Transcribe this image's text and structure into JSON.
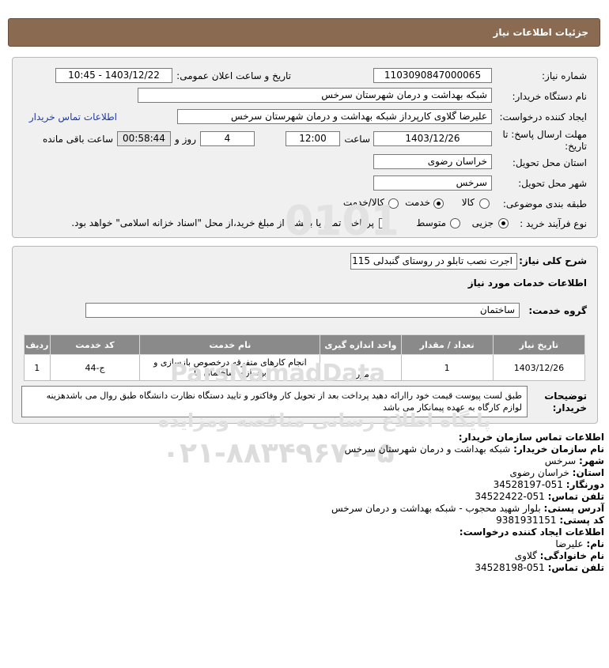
{
  "page": {
    "title": "جزئیات اطلاعات نیاز"
  },
  "details": {
    "need_number_label": "شماره نیاز:",
    "need_number": "1103090847000065",
    "announce_label": "تاریخ و ساعت اعلان عمومی:",
    "announce_value": "1403/12/22 - 10:45",
    "buyer_org_label": "نام دستگاه خریدار:",
    "buyer_org": "شبکه بهداشت و درمان شهرستان سرخس",
    "requester_label": "ایجاد کننده درخواست:",
    "requester": "علیرضا گلاوی کارپرداز شبکه بهداشت و درمان شهرستان سرخس",
    "contact_link": "اطلاعات تماس خریدار",
    "deadline_label_1": "مهلت ارسال پاسخ: تا",
    "deadline_label_2": "تاریخ:",
    "deadline_date": "1403/12/26",
    "time_label": "ساعت",
    "deadline_time": "12:00",
    "days_value": "4",
    "days_label": "روز و",
    "remaining_time": "00:58:44",
    "remaining_label": "ساعت باقی مانده",
    "province_label": "استان محل تحویل:",
    "province": "خراسان رضوی",
    "city_label": "شهر محل تحویل:",
    "city": "سرخس",
    "category_label": "طبقه بندی موضوعی:",
    "category_options": [
      "کالا",
      "خدمت",
      "کالا/خدمت"
    ],
    "category_selected": "خدمت",
    "process_label": "نوع فرآیند خرید :",
    "process_options": [
      "جزیی",
      "متوسط"
    ],
    "process_selected": "جزیی",
    "payment_note": "پرداخت تمام یا بخشی از مبلغ خرید،از محل \"اسناد خزانه اسلامی\" خواهد بود."
  },
  "summary": {
    "desc_label": "شرح کلی نیاز:",
    "desc_value": "اجرت نصب تابلو در روستای گنبدلی 115",
    "services_heading": "اطلاعات خدمات مورد نیاز",
    "group_label": "گروه خدمت:",
    "group_value": "ساختمان"
  },
  "table": {
    "headers": [
      "ردیف",
      "کد خدمت",
      "نام خدمت",
      "واحد اندازه گیری",
      "تعداد / مقدار",
      "تاریخ نیاز"
    ],
    "rows": [
      [
        "1",
        "ج-44",
        "انجام کارهای متفرقه درخصوص بازسازی و بهسازی ساختمان ها",
        "مورد",
        "1",
        "1403/12/26"
      ]
    ]
  },
  "buyer_notes": {
    "label_1": "توضیحات",
    "label_2": "خریدار:",
    "text": "طبق لست پیوست قیمت خود راارائه دهید پرداخت بعد از تحویل کار وفاکتور و تایید دستگاه نظارت دانشگاه طبق روال می باشدهزینه لوازم کارگاه به عهده پیمانکار می باشد"
  },
  "contact": {
    "org_heading": "اطلاعات تماس سازمان خریدار:",
    "org_name_label": "نام سازمان خریدار:",
    "org_name": "شبکه بهداشت و درمان شهرستان سرخس",
    "city_label": "شهر:",
    "city": "سرخس",
    "province_label": "استان:",
    "province": "خراسان رضوی",
    "fax_label": "دورنگار:",
    "fax": "051-34528197",
    "phone_label": "تلفن تماس:",
    "phone": "051-34522422",
    "address_label": "آدرس پستی:",
    "address": "بلوار شهید محجوب - شبکه بهداشت و درمان سرخس",
    "postal_label": "کد پستی:",
    "postal": "9381931151",
    "creator_heading": "اطلاعات ایجاد کننده درخواست:",
    "first_name_label": "نام:",
    "first_name": "علیرضا",
    "last_name_label": "نام خانوادگی:",
    "last_name": "گلاوی",
    "creator_phone_label": "تلفن تماس:",
    "creator_phone": "051-34528198"
  },
  "watermark": {
    "line_1": "ParsNamadData",
    "line_2": "پایگاه اطلاع رسانی مناقصه ومزایده",
    "line_3": "۰۲۱-۸۸۳۴۹۶۷۰-۵",
    "line_4": "0101"
  },
  "colors": {
    "titlebar": "#8a6a50",
    "table_header": "#8a8a8a",
    "link": "#1a3aa8"
  }
}
